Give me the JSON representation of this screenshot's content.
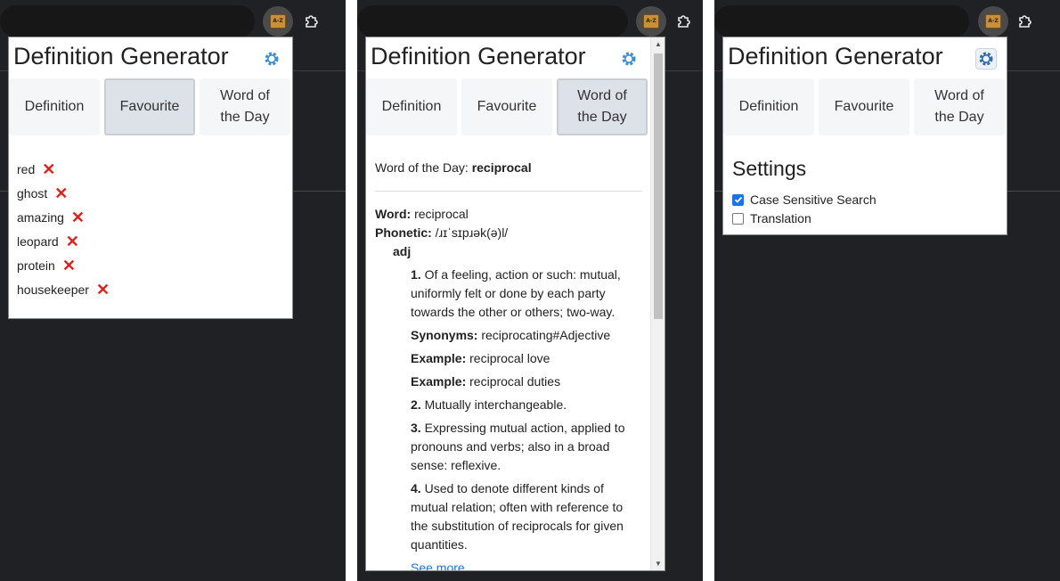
{
  "app": {
    "title": "Definition Generator"
  },
  "tabs": [
    "Definition",
    "Favourite",
    "Word of\nthe Day"
  ],
  "favourites": [
    "red",
    "ghost",
    "amazing",
    "leopard",
    "protein",
    "housekeeper"
  ],
  "word_of_the_day": {
    "label": "Word of the Day: ",
    "word": "reciprocal",
    "word_label": "Word:",
    "phonetic_label": "Phonetic:",
    "phonetic": "/ɹɪˈsɪpɹək(ə)l/",
    "part_of_speech": "adj",
    "senses": [
      {
        "num": "1.",
        "text": "Of a feeling, action or such: mutual, uniformly felt or done by each party towards the other or others; two-way."
      },
      {
        "num": "Synonyms:",
        "text": "reciprocating#Adjective"
      },
      {
        "num": "Example:",
        "text": "reciprocal love"
      },
      {
        "num": "Example:",
        "text": "reciprocal duties"
      },
      {
        "num": "2.",
        "text": "Mutually interchangeable."
      },
      {
        "num": "3.",
        "text": "Expressing mutual action, applied to pronouns and verbs; also in a broad sense: reflexive."
      },
      {
        "num": "4.",
        "text": "Used to denote different kinds of mutual relation; often with reference to the substitution of reciprocals for given quantities."
      }
    ],
    "see_more": "See more"
  },
  "settings": {
    "title": "Settings",
    "options": [
      {
        "label": "Case Sensitive Search",
        "checked": true
      },
      {
        "label": "Translation",
        "checked": false
      }
    ]
  },
  "browser": {
    "extension_icon_text": "A-Z"
  },
  "colors": {
    "accent": "#1a73e8",
    "remove": "#e0201b",
    "gear": "#3b8ed6"
  }
}
